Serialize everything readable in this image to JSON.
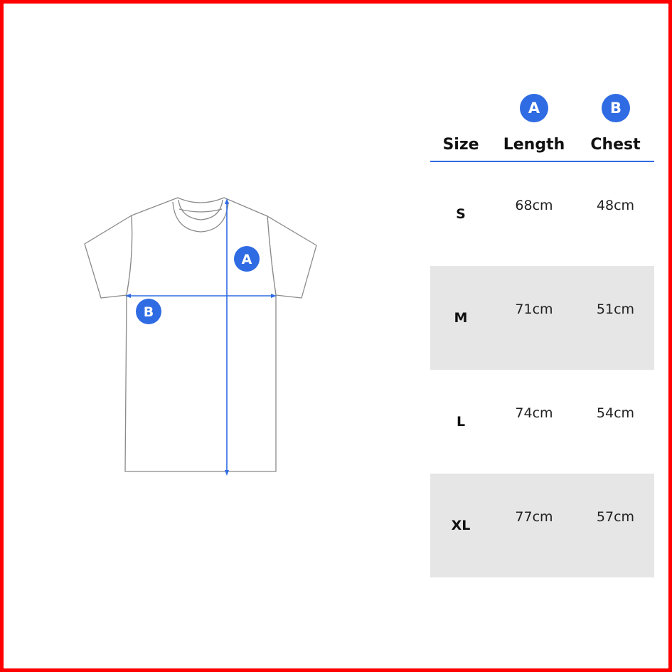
{
  "colors": {
    "accent": "#2f6be3",
    "frame": "#ff0000",
    "row_shade": "#e6e6e6",
    "outline": "#8a8a8a"
  },
  "diagram": {
    "label_length": "A",
    "label_chest": "B"
  },
  "table": {
    "header_badges": {
      "length": "A",
      "chest": "B"
    },
    "headers": {
      "size": "Size",
      "length": "Length",
      "chest": "Chest"
    },
    "rows": [
      {
        "size": "S",
        "length": "68cm",
        "chest": "48cm"
      },
      {
        "size": "M",
        "length": "71cm",
        "chest": "51cm"
      },
      {
        "size": "L",
        "length": "74cm",
        "chest": "54cm"
      },
      {
        "size": "XL",
        "length": "77cm",
        "chest": "57cm"
      }
    ]
  }
}
